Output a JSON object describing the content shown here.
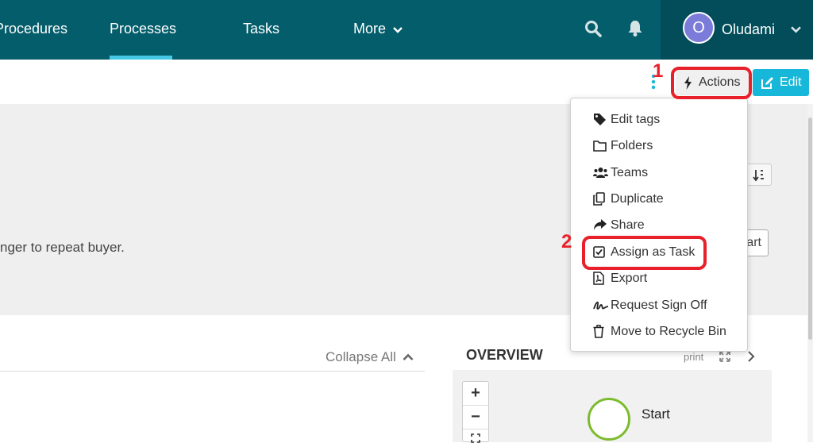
{
  "nav": {
    "items": [
      "Procedures",
      "Processes",
      "Tasks",
      "More"
    ],
    "user": {
      "initial": "O",
      "name": "Oludami"
    }
  },
  "toolbar": {
    "actions_label": "Actions",
    "edit_label": "Edit"
  },
  "annotations": {
    "step1": "1",
    "step2": "2"
  },
  "actions_menu": {
    "items": [
      {
        "label": "Edit tags",
        "icon": "tag-icon"
      },
      {
        "label": "Folders",
        "icon": "folder-icon"
      },
      {
        "label": "Teams",
        "icon": "users-icon"
      },
      {
        "label": "Duplicate",
        "icon": "copy-icon"
      },
      {
        "label": "Share",
        "icon": "share-icon"
      },
      {
        "label": "Assign as Task",
        "icon": "check-square-icon"
      },
      {
        "label": "Export",
        "icon": "pdf-file-icon"
      },
      {
        "label": "Request Sign Off",
        "icon": "signature-icon"
      },
      {
        "label": "Move to Recycle Bin",
        "icon": "trash-icon"
      }
    ]
  },
  "header_panel": {
    "description": "nger to repeat buyer.",
    "start_button": "art"
  },
  "steps": {
    "collapse_all": "Collapse All"
  },
  "overview": {
    "title": "OVERVIEW",
    "print_label": "print",
    "start_node_label": "Start",
    "zoom_in": "+",
    "zoom_out": "−"
  },
  "colors": {
    "nav_bg": "#045d6b",
    "accent": "#45c8e6",
    "edit_button": "#17b7d9",
    "highlight": "#e8202a",
    "start_node": "#7dbb2e"
  }
}
